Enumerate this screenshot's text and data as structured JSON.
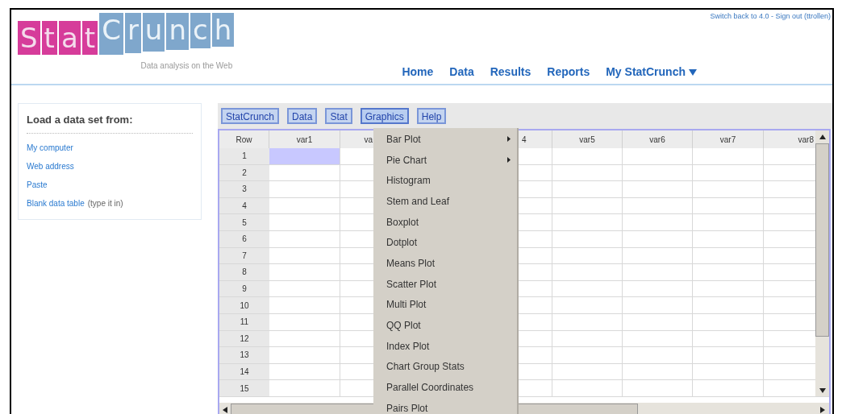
{
  "logo": {
    "first_word": "Stat",
    "second_word": "Crunch",
    "tagline": "Data analysis on the Web"
  },
  "account_links": "Switch back to 4.0 - Sign out (ttrollen)",
  "nav": [
    {
      "label": "Home",
      "dropdown": false
    },
    {
      "label": "Data",
      "dropdown": false
    },
    {
      "label": "Results",
      "dropdown": false
    },
    {
      "label": "Reports",
      "dropdown": false
    },
    {
      "label": "My StatCrunch",
      "dropdown": true
    }
  ],
  "load_panel": {
    "title": "Load a data set from:",
    "links": [
      {
        "label": "My computer"
      },
      {
        "label": "Web address"
      },
      {
        "label": "Paste"
      },
      {
        "label": "Blank data table",
        "note": "(type it in)"
      }
    ]
  },
  "toolbar": [
    {
      "label": "StatCrunch",
      "selected": false
    },
    {
      "label": "Data",
      "selected": false
    },
    {
      "label": "Stat",
      "selected": false
    },
    {
      "label": "Graphics",
      "selected": true
    },
    {
      "label": "Help",
      "selected": false
    }
  ],
  "grid": {
    "columns": [
      {
        "label": "Row"
      },
      {
        "label": "var1"
      },
      {
        "label": "va"
      },
      {},
      {
        "label": "4"
      },
      {
        "label": "var5"
      },
      {
        "label": "var6"
      },
      {
        "label": "var7"
      },
      {
        "label": "var8"
      }
    ],
    "rows": [
      {
        "number": "1",
        "selected": true
      },
      {
        "number": "2",
        "selected": false
      },
      {
        "number": "3",
        "selected": false
      },
      {
        "number": "4",
        "selected": false
      },
      {
        "number": "5",
        "selected": false
      },
      {
        "number": "6",
        "selected": false
      },
      {
        "number": "7",
        "selected": false
      },
      {
        "number": "8",
        "selected": false
      },
      {
        "number": "9",
        "selected": false
      },
      {
        "number": "10",
        "selected": false
      },
      {
        "number": "11",
        "selected": false
      },
      {
        "number": "12",
        "selected": false
      },
      {
        "number": "13",
        "selected": false
      },
      {
        "number": "14",
        "selected": false
      },
      {
        "number": "15",
        "selected": false
      }
    ]
  },
  "graphics_menu": [
    {
      "label": "Bar Plot",
      "submenu": true
    },
    {
      "label": "Pie Chart",
      "submenu": true
    },
    {
      "label": "Histogram",
      "submenu": false
    },
    {
      "label": "Stem and Leaf",
      "submenu": false
    },
    {
      "label": "Boxplot",
      "submenu": false
    },
    {
      "label": "Dotplot",
      "submenu": false
    },
    {
      "label": "Means Plot",
      "submenu": false
    },
    {
      "label": "Scatter Plot",
      "submenu": false
    },
    {
      "label": "Multi Plot",
      "submenu": false
    },
    {
      "label": "QQ Plot",
      "submenu": false
    },
    {
      "label": "Index Plot",
      "submenu": false
    },
    {
      "label": "Chart Group Stats",
      "submenu": false
    },
    {
      "label": "Parallel Coordinates",
      "submenu": false
    },
    {
      "label": "Pairs Plot",
      "submenu": false
    }
  ]
}
